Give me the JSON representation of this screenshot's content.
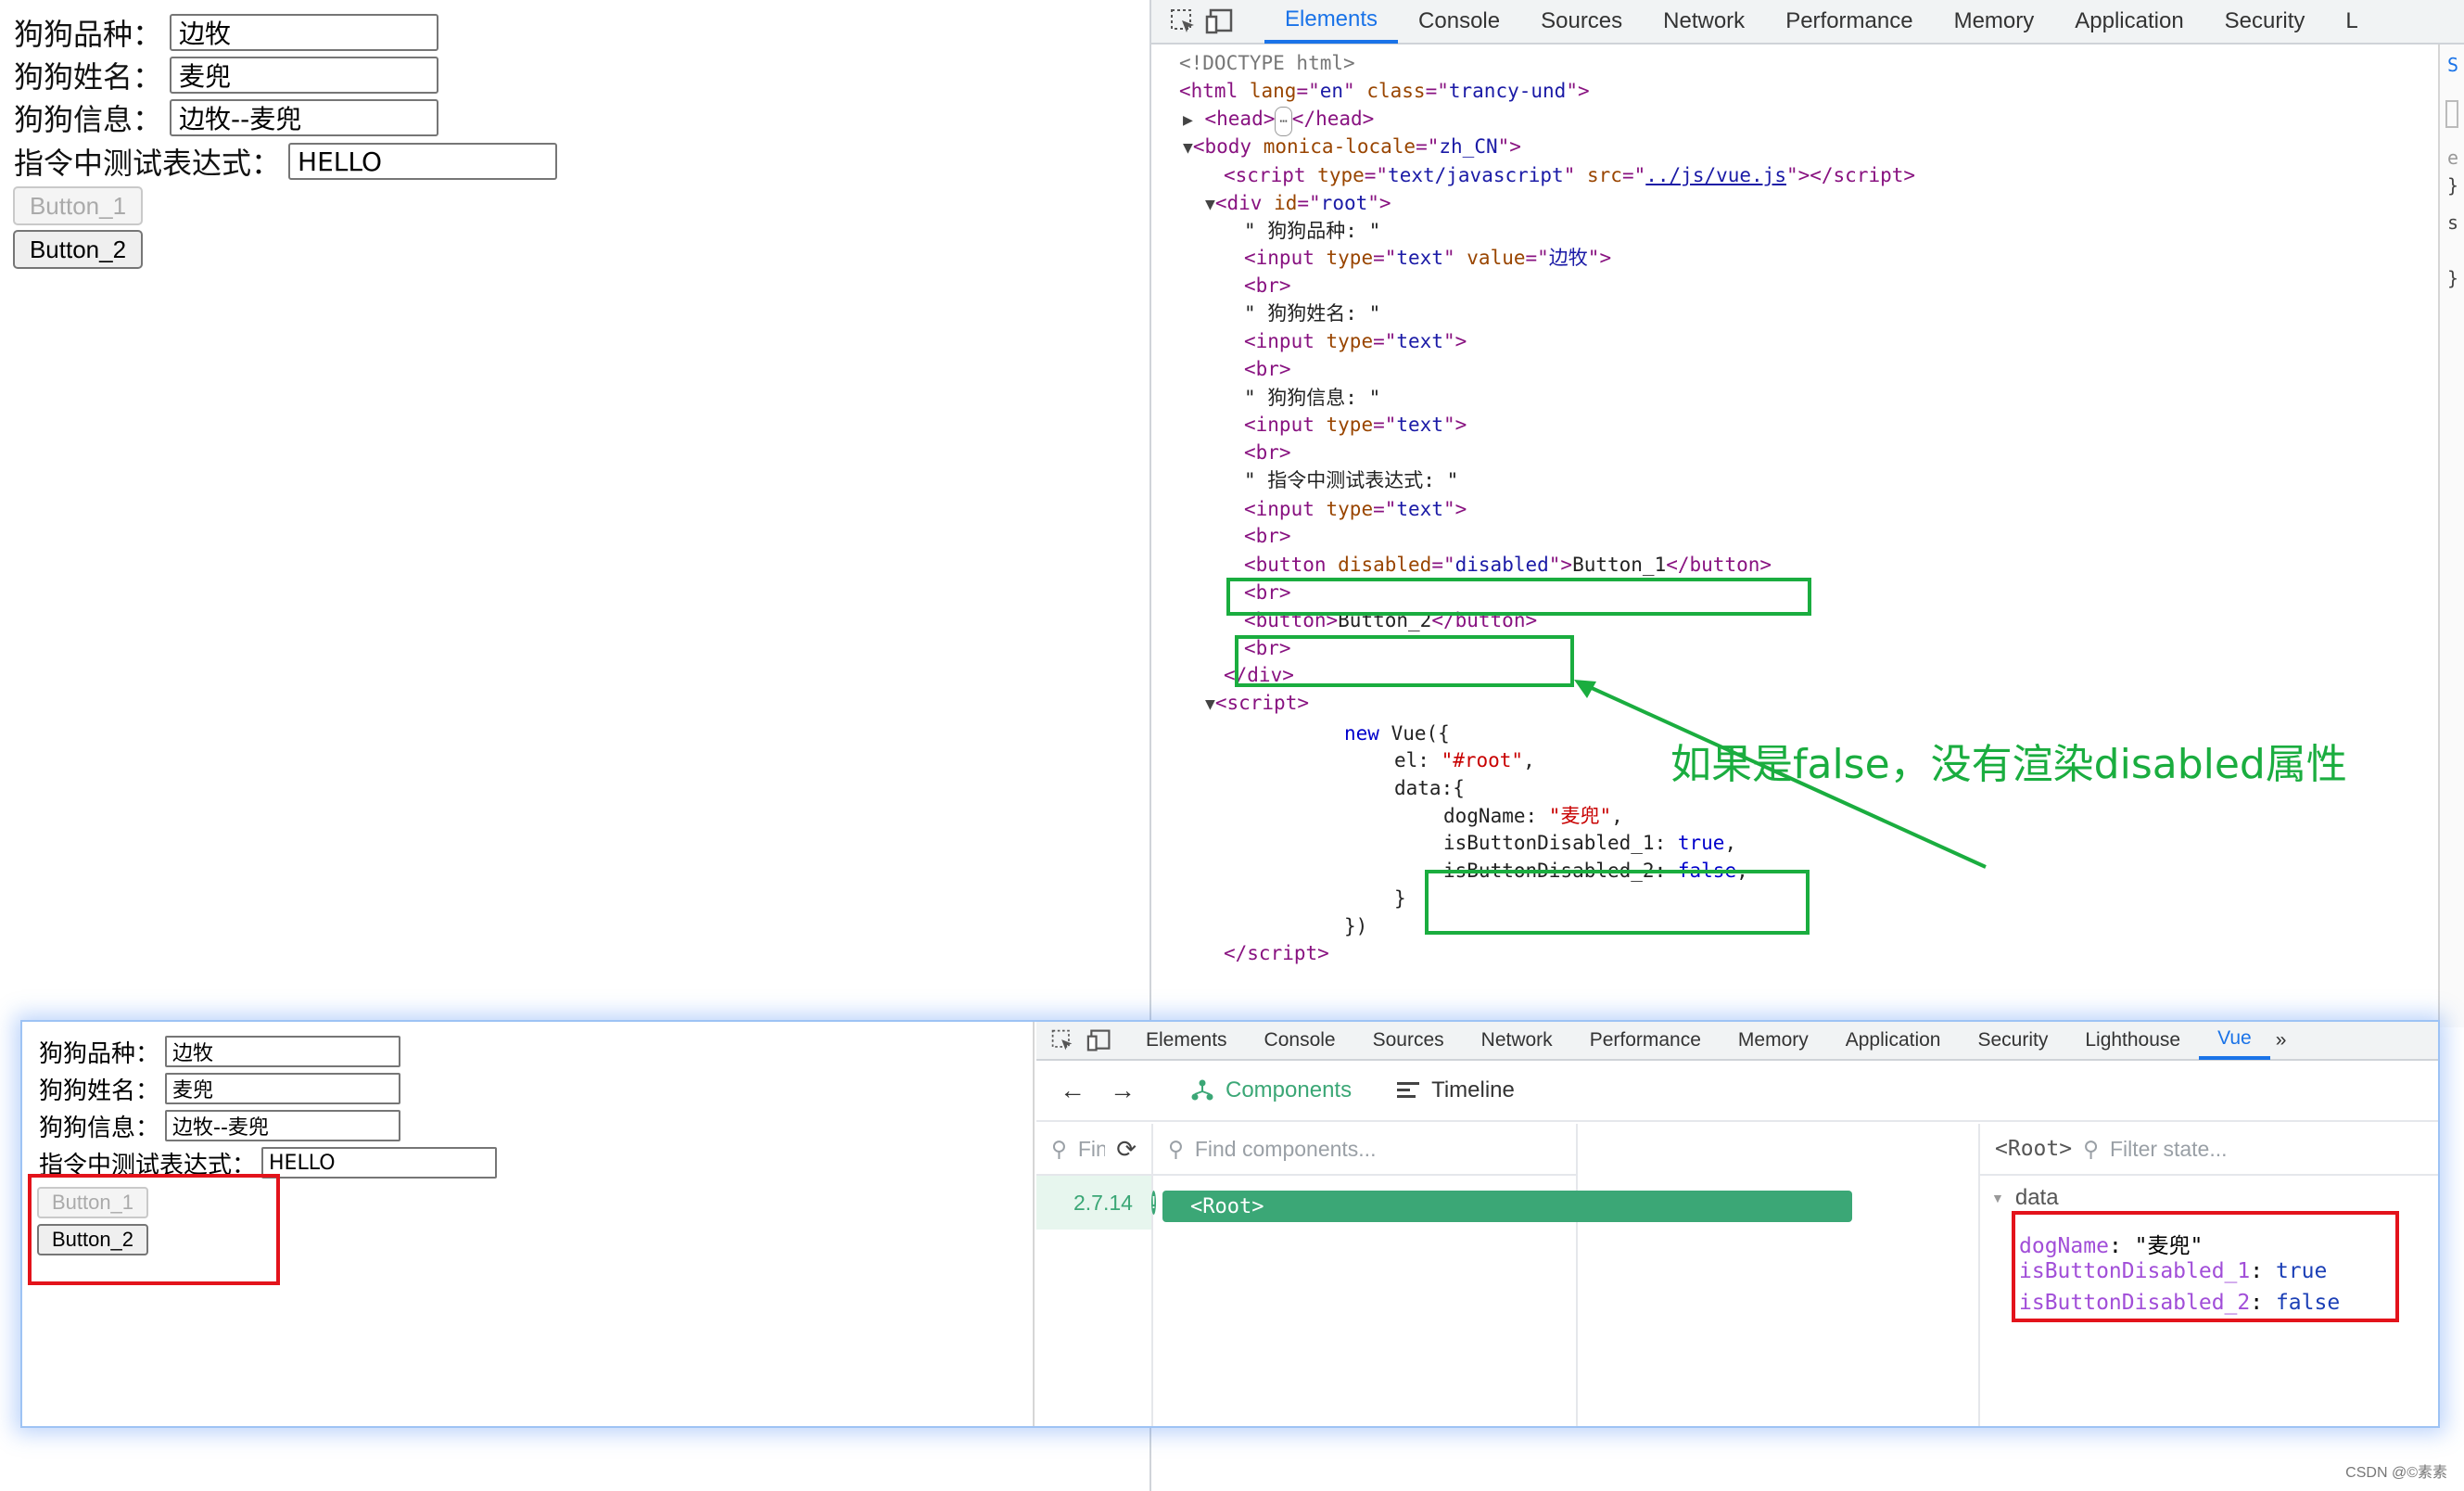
{
  "page_preview": {
    "fields": [
      {
        "label": "狗狗品种：",
        "value": "边牧"
      },
      {
        "label": "狗狗姓名：",
        "value": "麦兜"
      },
      {
        "label": "狗狗信息：",
        "value": "边牧--麦兜"
      },
      {
        "label": "指令中测试表达式：",
        "value": "HELLO"
      }
    ],
    "button_1": "Button_1",
    "button_2": "Button_2"
  },
  "devtools": {
    "tabs": [
      "Elements",
      "Console",
      "Sources",
      "Network",
      "Performance",
      "Memory",
      "Application",
      "Security",
      "L"
    ],
    "active_tab": "Elements",
    "dom": {
      "doctype": "<!DOCTYPE html>",
      "html_lang": "en",
      "html_class": "trancy-und",
      "body_locale": "zh_CN",
      "script_type": "text/javascript",
      "script_src": "../js/vue.js",
      "div_id": "root",
      "text_breed": "\" 狗狗品种: \"",
      "input_value": "边牧",
      "text_name": "\" 狗狗姓名: \"",
      "text_info": "\" 狗狗信息: \"",
      "text_expr": "\" 指令中测试表达式: \"",
      "btn_disabled_value": "disabled",
      "btn1_text": "Button_1",
      "btn2_text": "Button_2",
      "js_new_vue": "new Vue({",
      "js_el_key": "el: ",
      "js_el_val": "\"#root\"",
      "js_data": "data:{",
      "js_dogname_key": "dogName: ",
      "js_dogname_val": "\"麦兜\"",
      "js_flag1": "isButtonDisabled_1: ",
      "js_flag1_val": "true",
      "js_flag2": "isButtonDisabled_2: ",
      "js_flag2_val": "false",
      "js_close_brace": "}",
      "js_close_vue": "})"
    },
    "annotation": "如果是false，没有渲染disabled属性"
  },
  "overlay": {
    "fields": [
      {
        "label": "狗狗品种：",
        "value": "边牧"
      },
      {
        "label": "狗狗姓名：",
        "value": "麦兜"
      },
      {
        "label": "狗狗信息：",
        "value": "边牧--麦兜"
      },
      {
        "label": "指令中测试表达式：",
        "value": "HELLO"
      }
    ],
    "button_1": "Button_1",
    "button_2": "Button_2",
    "vue_devtools": {
      "tabs": [
        "Elements",
        "Console",
        "Sources",
        "Network",
        "Performance",
        "Memory",
        "Application",
        "Security",
        "Lighthouse",
        "Vue"
      ],
      "active_tab": "Vue",
      "nav_components": "Components",
      "nav_timeline": "Timeline",
      "find_app_placeholder": "Find a",
      "find_components_placeholder": "Find components...",
      "version": "2.7.14",
      "root_node": "<Root>",
      "state_root": "<Root>",
      "filter_state_placeholder": "Filter state...",
      "state_section": "data",
      "state": [
        {
          "key": "dogName",
          "value": "\"麦兜\""
        },
        {
          "key": "isButtonDisabled_1",
          "value": "true"
        },
        {
          "key": "isButtonDisabled_2",
          "value": "false"
        }
      ]
    }
  },
  "watermark": "CSDN @©素素",
  "colors": {
    "annotation_green": "#1aad3f",
    "highlight_red": "#e3131b",
    "vue_green": "#3ba776",
    "devtools_blue": "#1a73e8"
  }
}
